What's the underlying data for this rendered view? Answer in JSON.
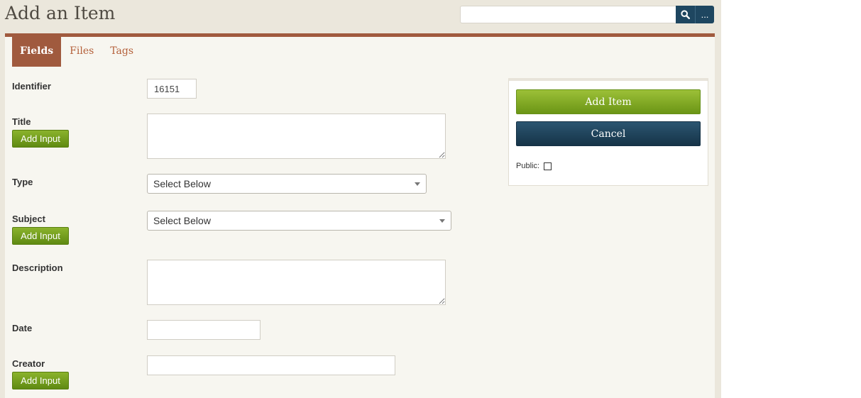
{
  "header": {
    "title": "Add an Item",
    "search_placeholder": "",
    "advanced_label": "..."
  },
  "tabs": [
    {
      "label": "Fields",
      "active": true
    },
    {
      "label": "Files",
      "active": false
    },
    {
      "label": "Tags",
      "active": false
    }
  ],
  "fields": {
    "identifier": {
      "label": "Identifier",
      "value": "16151"
    },
    "title": {
      "label": "Title",
      "add_input_label": "Add Input",
      "value": ""
    },
    "type": {
      "label": "Type",
      "selected": "Select Below"
    },
    "subject": {
      "label": "Subject",
      "add_input_label": "Add Input",
      "selected": "Select Below"
    },
    "description": {
      "label": "Description",
      "value": ""
    },
    "date": {
      "label": "Date",
      "value": ""
    },
    "creator": {
      "label": "Creator",
      "add_input_label": "Add Input",
      "value": ""
    }
  },
  "save_panel": {
    "add_item_label": "Add Item",
    "cancel_label": "Cancel",
    "public_label": "Public:",
    "public_checked": false
  },
  "colors": {
    "accent": "#a05a3e",
    "green_button": "#7aa31e",
    "dark_button": "#1e4660",
    "background": "#ebe7dc"
  }
}
